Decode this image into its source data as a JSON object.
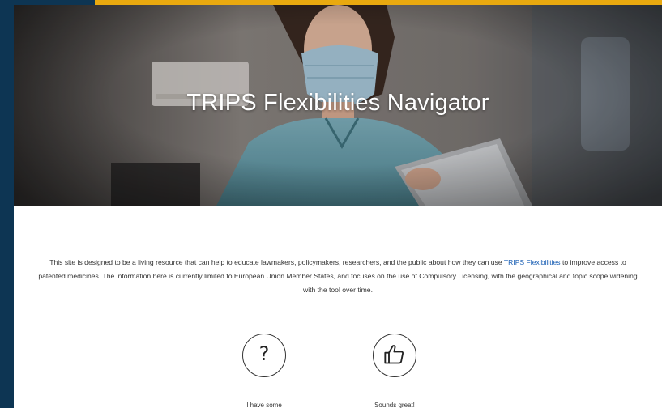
{
  "hero": {
    "title": "TRIPS Flexibilities Navigator"
  },
  "intro": {
    "text_before_link": "This site is designed to be a living resource that can help to educate lawmakers, policymakers, researchers, and the public about how they can use ",
    "link_text": "TRIPS Flexibilities",
    "text_after_link": " to improve access to patented medicines. The information here is currently limited to European Union Member States, and focuses on the use of Compulsory Licensing, with the geographical and topic scope widening with the tool over time."
  },
  "choices": [
    {
      "icon": "question-mark-icon",
      "label": "I have some"
    },
    {
      "icon": "thumbs-up-icon",
      "label": "Sounds great!"
    }
  ],
  "colors": {
    "frame": "#0d3553",
    "accent": "#e9a90f",
    "link": "#1a5fb4"
  }
}
